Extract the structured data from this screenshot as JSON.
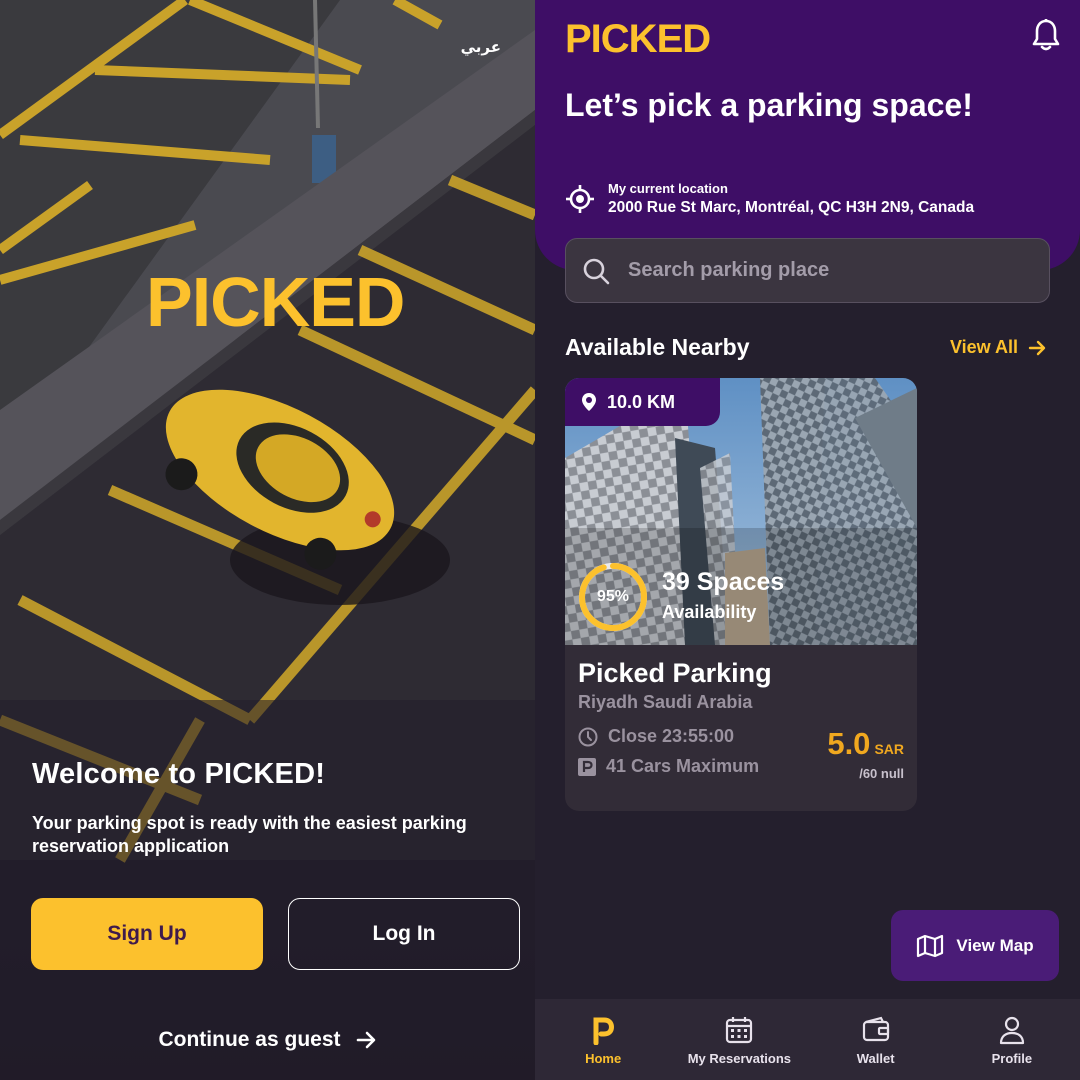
{
  "colors": {
    "accent": "#fcc12d",
    "purple": "#3e0e66",
    "background": "#241f2d",
    "price": "#f0a81f"
  },
  "welcome_screen": {
    "language_toggle": "عربي",
    "logo_text": "PICKED",
    "title": "Welcome to PICKED!",
    "subtitle": "Your parking spot is ready with the easiest parking reservation application",
    "signup_label": "Sign Up",
    "login_label": "Log In",
    "guest_label": "Continue as guest",
    "guest_icon": "arrow-right-icon"
  },
  "home_screen": {
    "logo_text": "PICKED",
    "notification_icon": "bell-icon",
    "hero_title": "Let’s pick a parking space!",
    "location": {
      "icon": "crosshair-icon",
      "label": "My current location",
      "address": "2000 Rue St Marc, Montréal, QC H3H 2N9, Canada"
    },
    "search": {
      "icon": "search-icon",
      "placeholder": "Search parking place"
    },
    "section_title": "Available Nearby",
    "view_all_label": "View All",
    "card": {
      "distance": "10.0 KM",
      "availability_percent": 95,
      "availability_percent_label": "95%",
      "spaces": "39 Spaces",
      "availability_label": "Availability",
      "name": "Picked Parking",
      "city": "Riyadh Saudi Arabia",
      "close_time": "Close 23:55:00",
      "max_cars": "41 Cars Maximum",
      "price": "5.0",
      "currency": "SAR",
      "price_unit": "/60 null"
    },
    "view_map_label": "View Map",
    "bottom_nav": [
      {
        "label": "Home",
        "icon": "home-p-icon",
        "active": true
      },
      {
        "label": "My Reservations",
        "icon": "calendar-icon",
        "active": false
      },
      {
        "label": "Wallet",
        "icon": "wallet-icon",
        "active": false
      },
      {
        "label": "Profile",
        "icon": "user-icon",
        "active": false
      }
    ]
  }
}
